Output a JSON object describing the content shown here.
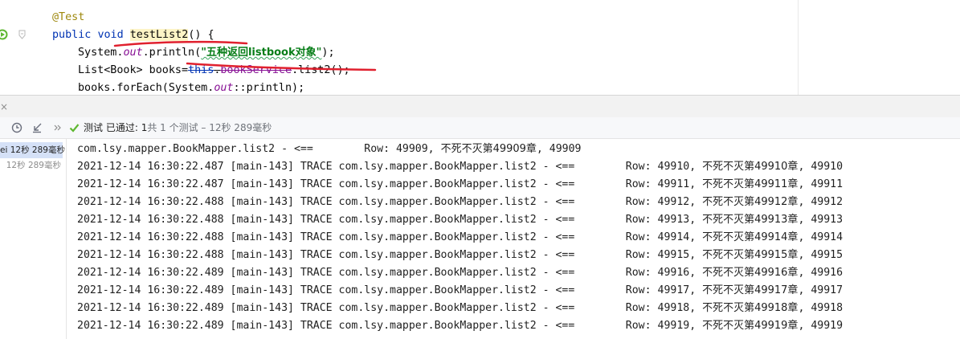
{
  "editor": {
    "line1": {
      "annotation": "@Test"
    },
    "line2": {
      "kw_public": "public",
      "kw_void": "void",
      "method": "testList2",
      "rest": "() {"
    },
    "line3": {
      "pre": "System.",
      "field": "out",
      "mid": ".println(",
      "str": "\"五种返回listbook对象\"",
      "post": ");"
    },
    "line4": {
      "pre": "List<Book> books=",
      "kw_this": "this",
      "dot": ".",
      "field": "bookService",
      "post": ".list2();"
    },
    "line5": {
      "pre": "books.forEach(System.",
      "field": "out",
      "post": "::println);"
    }
  },
  "panel": {
    "close_glyph": "×",
    "status": {
      "label": "测试 已通过: ",
      "passed": "1",
      "detail": "共 1 个测试 – 12秒 289毫秒"
    }
  },
  "tree": {
    "row1": "ei 12秒 289毫秒",
    "row2": "12秒 289毫秒"
  },
  "console": {
    "first_line": {
      "text": "com.lsy.mapper.BookMapper.list2 - <==        Row: 49909, ",
      "cjk": "不死不灭第49909章",
      "tail": ", 49909"
    },
    "lines": [
      {
        "prefix": "2021-12-14 16:30:22.487 [main-143] TRACE com.lsy.mapper.BookMapper.list2 - <==        Row: 49910, ",
        "cjk": "不死不灭第49910章",
        "tail": ", 49910"
      },
      {
        "prefix": "2021-12-14 16:30:22.487 [main-143] TRACE com.lsy.mapper.BookMapper.list2 - <==        Row: 49911, ",
        "cjk": "不死不灭第49911章",
        "tail": ", 49911"
      },
      {
        "prefix": "2021-12-14 16:30:22.488 [main-143] TRACE com.lsy.mapper.BookMapper.list2 - <==        Row: 49912, ",
        "cjk": "不死不灭第49912章",
        "tail": ", 49912"
      },
      {
        "prefix": "2021-12-14 16:30:22.488 [main-143] TRACE com.lsy.mapper.BookMapper.list2 - <==        Row: 49913, ",
        "cjk": "不死不灭第49913章",
        "tail": ", 49913"
      },
      {
        "prefix": "2021-12-14 16:30:22.488 [main-143] TRACE com.lsy.mapper.BookMapper.list2 - <==        Row: 49914, ",
        "cjk": "不死不灭第49914章",
        "tail": ", 49914"
      },
      {
        "prefix": "2021-12-14 16:30:22.488 [main-143] TRACE com.lsy.mapper.BookMapper.list2 - <==        Row: 49915, ",
        "cjk": "不死不灭第49915章",
        "tail": ", 49915"
      },
      {
        "prefix": "2021-12-14 16:30:22.489 [main-143] TRACE com.lsy.mapper.BookMapper.list2 - <==        Row: 49916, ",
        "cjk": "不死不灭第49916章",
        "tail": ", 49916"
      },
      {
        "prefix": "2021-12-14 16:30:22.489 [main-143] TRACE com.lsy.mapper.BookMapper.list2 - <==        Row: 49917, ",
        "cjk": "不死不灭第49917章",
        "tail": ", 49917"
      },
      {
        "prefix": "2021-12-14 16:30:22.489 [main-143] TRACE com.lsy.mapper.BookMapper.list2 - <==        Row: 49918, ",
        "cjk": "不死不灭第49918章",
        "tail": ", 49918"
      },
      {
        "prefix": "2021-12-14 16:30:22.489 [main-143] TRACE com.lsy.mapper.BookMapper.list2 - <==        Row: 49919, ",
        "cjk": "不死不灭第49919章",
        "tail": ", 49919"
      }
    ]
  },
  "colors": {
    "keyword": "#0033b3",
    "annotation": "#9e880d",
    "string": "#067d17",
    "field": "#871094",
    "pass_green": "#5fb832",
    "scribble_red": "#e0202e",
    "selection": "#d5e1f7"
  },
  "icons": {
    "run": "run-gutter-icon",
    "fold": "fold-marker-icon",
    "close": "close-icon",
    "history": "test-history-icon",
    "import": "import-tests-icon",
    "expand": "chevron-double-right-icon",
    "passed": "check-icon"
  }
}
